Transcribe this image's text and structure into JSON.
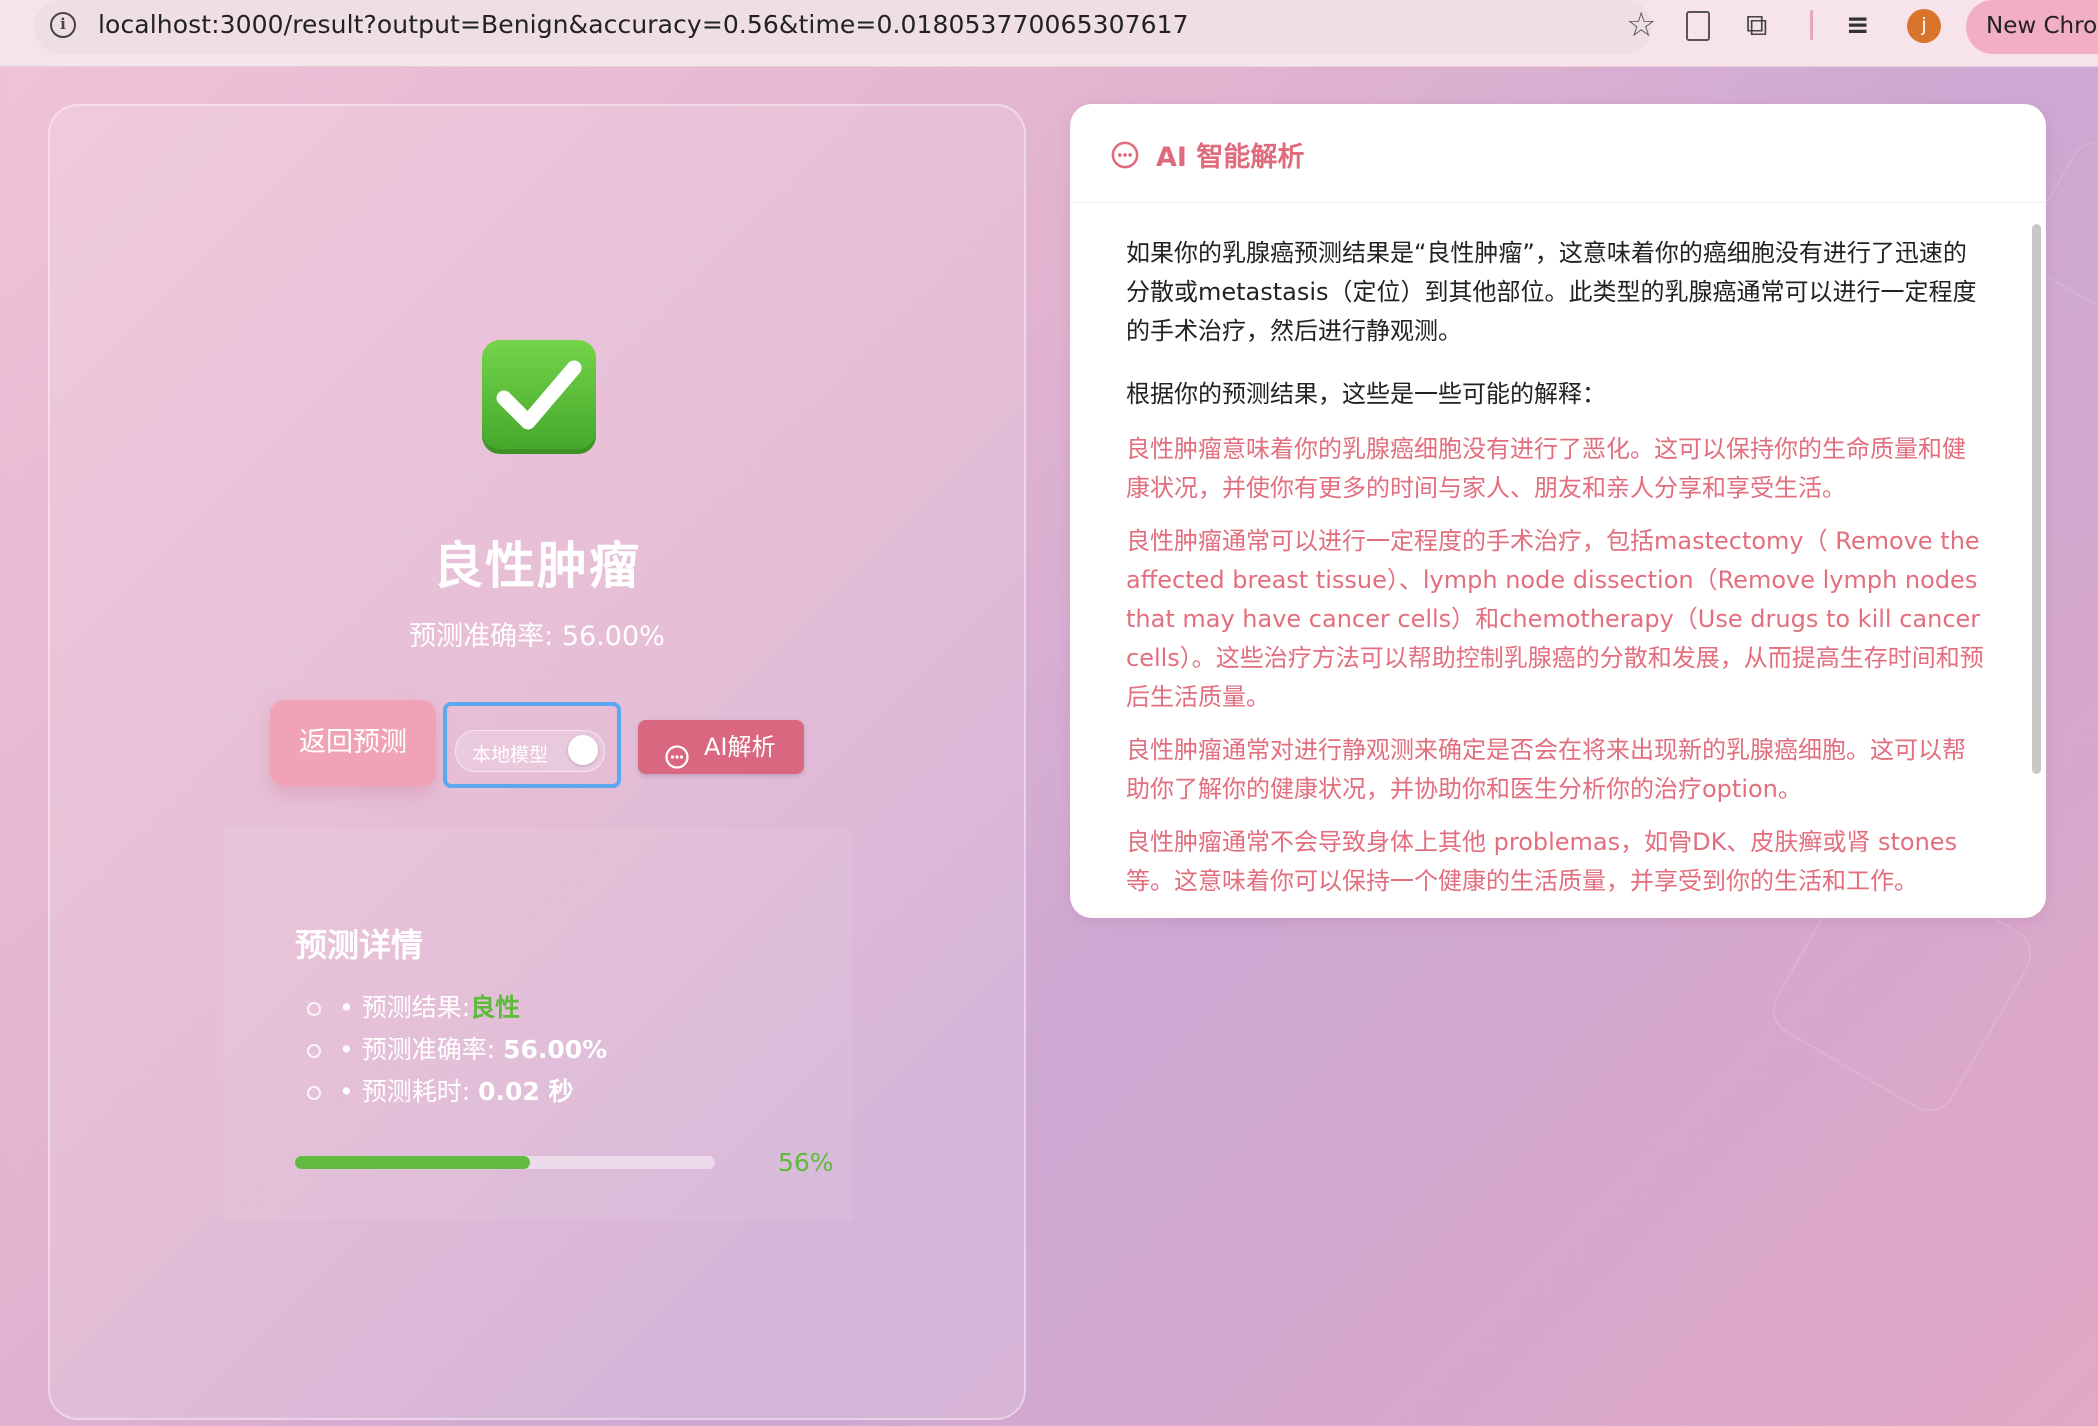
{
  "browser": {
    "url": "localhost:3000/result?output=Benign&accuracy=0.56&time=0.018053770065307617",
    "avatar_initial": "j",
    "new_chrome_label": "New Chro"
  },
  "result": {
    "title": "良性肿瘤",
    "accuracy_text": "预测准确率: 56.00%"
  },
  "buttons": {
    "back_label": "返回预测",
    "local_model_label": "本地模型",
    "local_model_on": true,
    "ai_label": "AI解析"
  },
  "details": {
    "title": "预测详情",
    "result_label": "• 预测结果:",
    "result_value": "良性",
    "accuracy_label": "• 预测准确率: ",
    "accuracy_value": "56.00%",
    "time_label": "• 预测耗时: ",
    "time_value": "0.02 秒",
    "progress_fraction": 0.56,
    "progress_text": "56%"
  },
  "ai_panel": {
    "title": "AI 智能解析",
    "intro": "如果你的乳腺癌预测结果是“良性肿瘤”，这意味着你的癌细胞没有进行了迅速的分散或metastasis（定位）到其他部位。此类型的乳腺癌通常可以进行一定程度的手术治疗，然后进行静观测。",
    "lead": "根据你的预测结果，这些是一些可能的解释：",
    "points": [
      "良性肿瘤意味着你的乳腺癌细胞没有进行了恶化。这可以保持你的生命质量和健康状况，并使你有更多的时间与家人、朋友和亲人分享和享受生活。",
      "良性肿瘤通常可以进行一定程度的手术治疗，包括mastectomy（ Remove the affected breast tissue）、lymph node dissection（Remove lymph nodes that may have cancer cells）和chemotherapy（Use drugs to kill cancer cells）。这些治疗方法可以帮助控制乳腺癌的分散和发展，从而提高生存时间和预后生活质量。",
      "良性肿瘤通常对进行静观测来确定是否会在将来出现新的乳腺癌细胞。这可以帮助你了解你的健康状况，并协助你和医生分析你的治疗option。",
      "良性肿瘤通常不会导致身体上其他 problemas，如骨DK、皮肤癣或肾 stones 等。这意味着你可以保持一个健康的生活质量，并享受到你的生活和工作。"
    ]
  },
  "colors": {
    "accent": "#e06b7d",
    "success": "#5dbb3a",
    "toggle_focus": "#5aa9f0"
  }
}
